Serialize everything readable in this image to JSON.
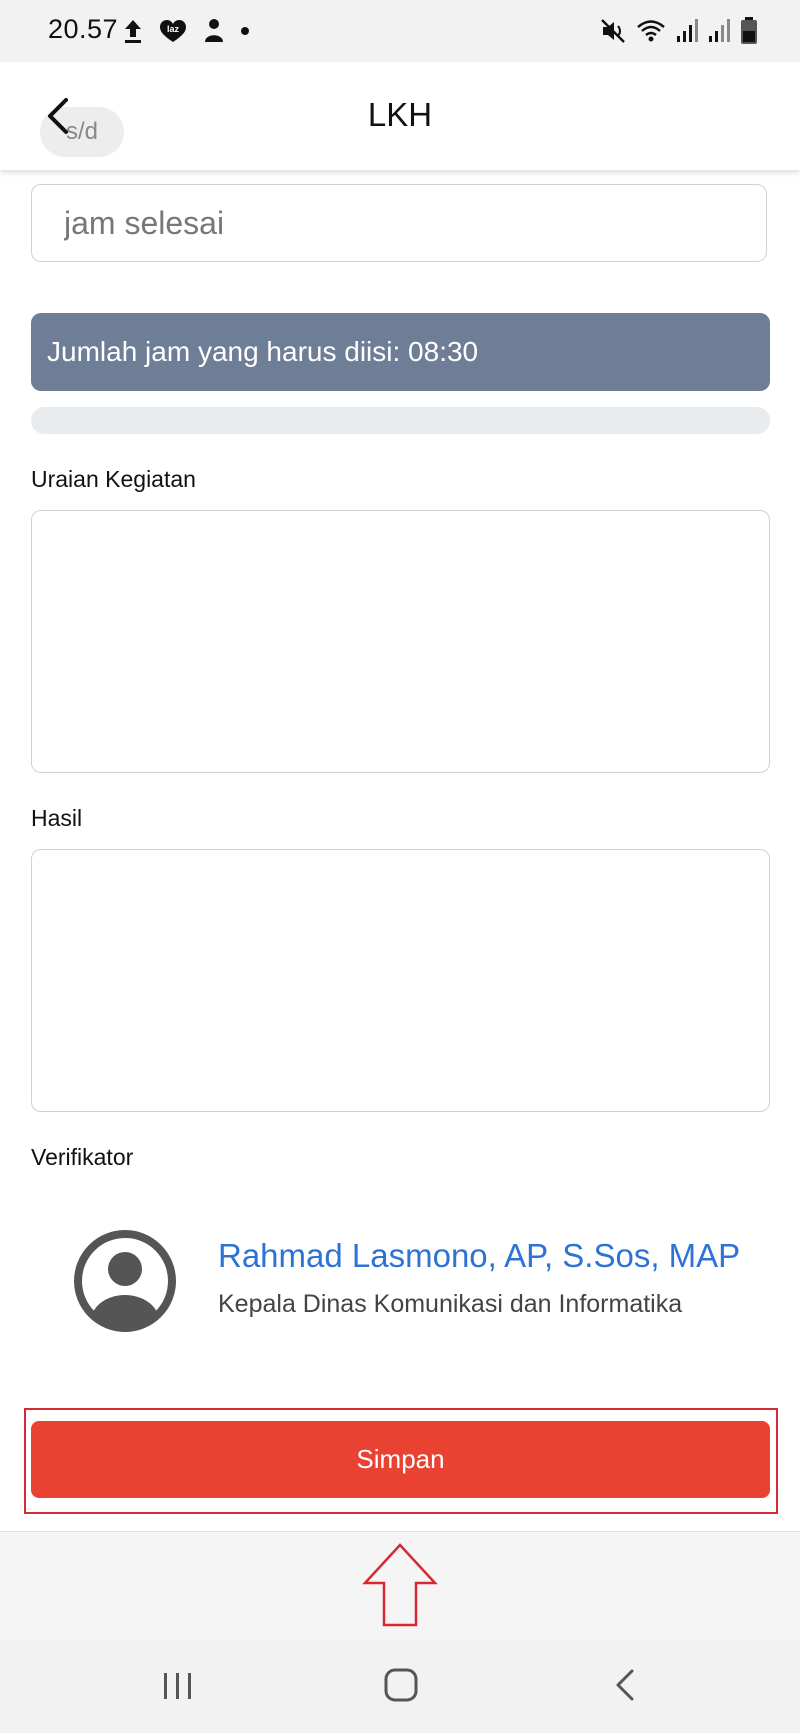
{
  "status_bar": {
    "time": "20.57",
    "left_icons": [
      "upload-icon",
      "lazada-notification-icon",
      "person-notification-icon",
      "dot-icon"
    ],
    "right_icons": [
      "mute-vibrate-icon",
      "wifi-icon",
      "signal-icon",
      "signal-icon",
      "battery-icon"
    ]
  },
  "header": {
    "title": "LKH",
    "back_icon": "chevron-left-icon",
    "range_separator": "s/d"
  },
  "form": {
    "end_time_placeholder": "jam selesai",
    "hours_info": "Jumlah jam yang harus diisi: 08:30",
    "progress_fraction": 0,
    "activity_label": "Uraian Kegiatan",
    "activity_value": "",
    "result_label": "Hasil",
    "result_value": "",
    "verifier_label": "Verifikator"
  },
  "verifier": {
    "avatar_icon": "user-circle-icon",
    "name": "Rahmad Lasmono, AP, S.Sos, MAP",
    "position": "Kepala Dinas Komunikasi dan Informatika"
  },
  "actions": {
    "save_label": "Simpan"
  },
  "annotation": {
    "outline_color": "#d42a36",
    "arrow_icon": "up-arrow-outline-icon"
  },
  "navigation_bar": {
    "icons": [
      "recents-icon",
      "home-icon",
      "back-icon"
    ]
  },
  "colors": {
    "info_bar": "#6e7e96",
    "save_button": "#ea4232",
    "verifier_name": "#2d73d6"
  }
}
